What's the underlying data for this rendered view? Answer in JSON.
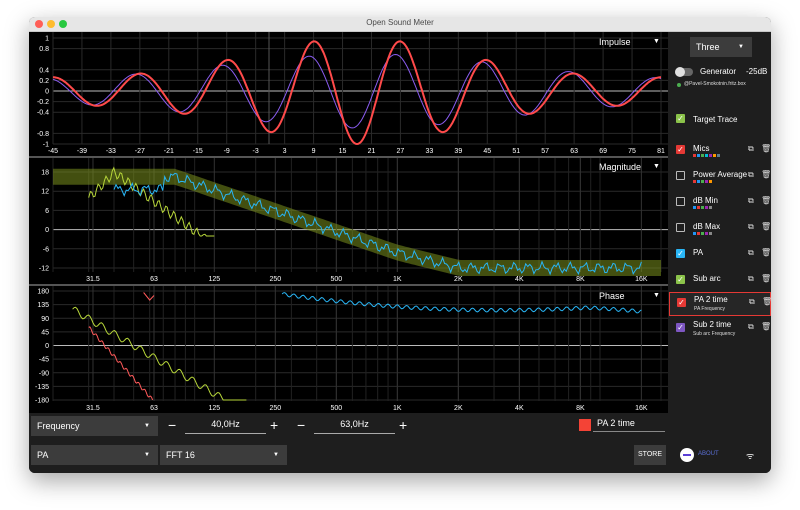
{
  "window": {
    "title": "Open Sound Meter"
  },
  "impulse": {
    "title": "Impulse",
    "y_ticks": [
      "1",
      "0.8",
      "0.4",
      "0.2",
      "0",
      "-0.2",
      "-0.4",
      "-0.8",
      "-1"
    ],
    "x_ticks": [
      "-45",
      "-39",
      "-33",
      "-27",
      "-21",
      "-15",
      "-9",
      "-3",
      "3",
      "9",
      "15",
      "21",
      "27",
      "33",
      "39",
      "45",
      "51",
      "57",
      "63",
      "69",
      "75",
      "81"
    ]
  },
  "magnitude": {
    "title": "Magnitude",
    "y_ticks": [
      "18",
      "12",
      "6",
      "0",
      "-6",
      "-12"
    ],
    "x_ticks": [
      "31.5",
      "63",
      "125",
      "250",
      "500",
      "1K",
      "2K",
      "4K",
      "8K",
      "16K"
    ]
  },
  "phase": {
    "title": "Phase",
    "y_ticks": [
      "180",
      "135",
      "90",
      "45",
      "0",
      "-45",
      "-90",
      "-135",
      "-180"
    ],
    "x_ticks": [
      "31.5",
      "63",
      "125",
      "250",
      "500",
      "1K",
      "2K",
      "4K",
      "8K",
      "16K"
    ]
  },
  "sidebar": {
    "layout_select": "Three",
    "generator": {
      "label": "Generator",
      "level": "-25dB",
      "author": "@Pavel-Smokotnin.fritz.box"
    },
    "target_trace": "Target Trace",
    "items": [
      {
        "name": "Mics",
        "checked": true,
        "color": "#e53935",
        "swatches": [
          "#e53935",
          "#2196f3",
          "#4caf50",
          "#00bcd4",
          "#9c27b0",
          "#ff9800",
          "#607d8b"
        ]
      },
      {
        "name": "Power Average",
        "checked": false,
        "color": "#888888",
        "swatches": [
          "#e53935",
          "#2196f3",
          "#4caf50",
          "#9c27b0",
          "#ff9800"
        ]
      },
      {
        "name": "dB Min",
        "checked": false,
        "color": "#888888",
        "swatches": [
          "#2196f3",
          "#e53935",
          "#4caf50",
          "#9c27b0",
          "#888888"
        ]
      },
      {
        "name": "dB Max",
        "checked": false,
        "color": "#888888",
        "swatches": [
          "#2196f3",
          "#e53935",
          "#4caf50",
          "#9c27b0",
          "#888888"
        ]
      },
      {
        "name": "PA",
        "checked": true,
        "color": "#29b6f6"
      },
      {
        "name": "Sub arc",
        "checked": true,
        "color": "#8bc34a"
      },
      {
        "name": "PA 2 time",
        "sub": "PA Frequency",
        "checked": true,
        "color": "#e53935",
        "selected": true
      },
      {
        "name": "Sub 2 time",
        "sub": "Sub arc Frequency",
        "checked": true,
        "color": "#7e57c2"
      }
    ]
  },
  "bottom": {
    "mode": "Frequency",
    "freq1": "40,0Hz",
    "freq2": "63,0Hz",
    "selected_trace": "PA 2 time",
    "selected_color": "#f44336",
    "source": "PA",
    "fft": "FFT 16",
    "store": "STORE",
    "about": "ABOUT"
  },
  "colors": {
    "impulse_red": "#ff4a4a",
    "impulse_purple": "#8a5cf0",
    "pa": "#29b6f6",
    "sub": "#b7d63a",
    "target": "#7a8f1e",
    "mics_red": "#ff5a5a"
  }
}
